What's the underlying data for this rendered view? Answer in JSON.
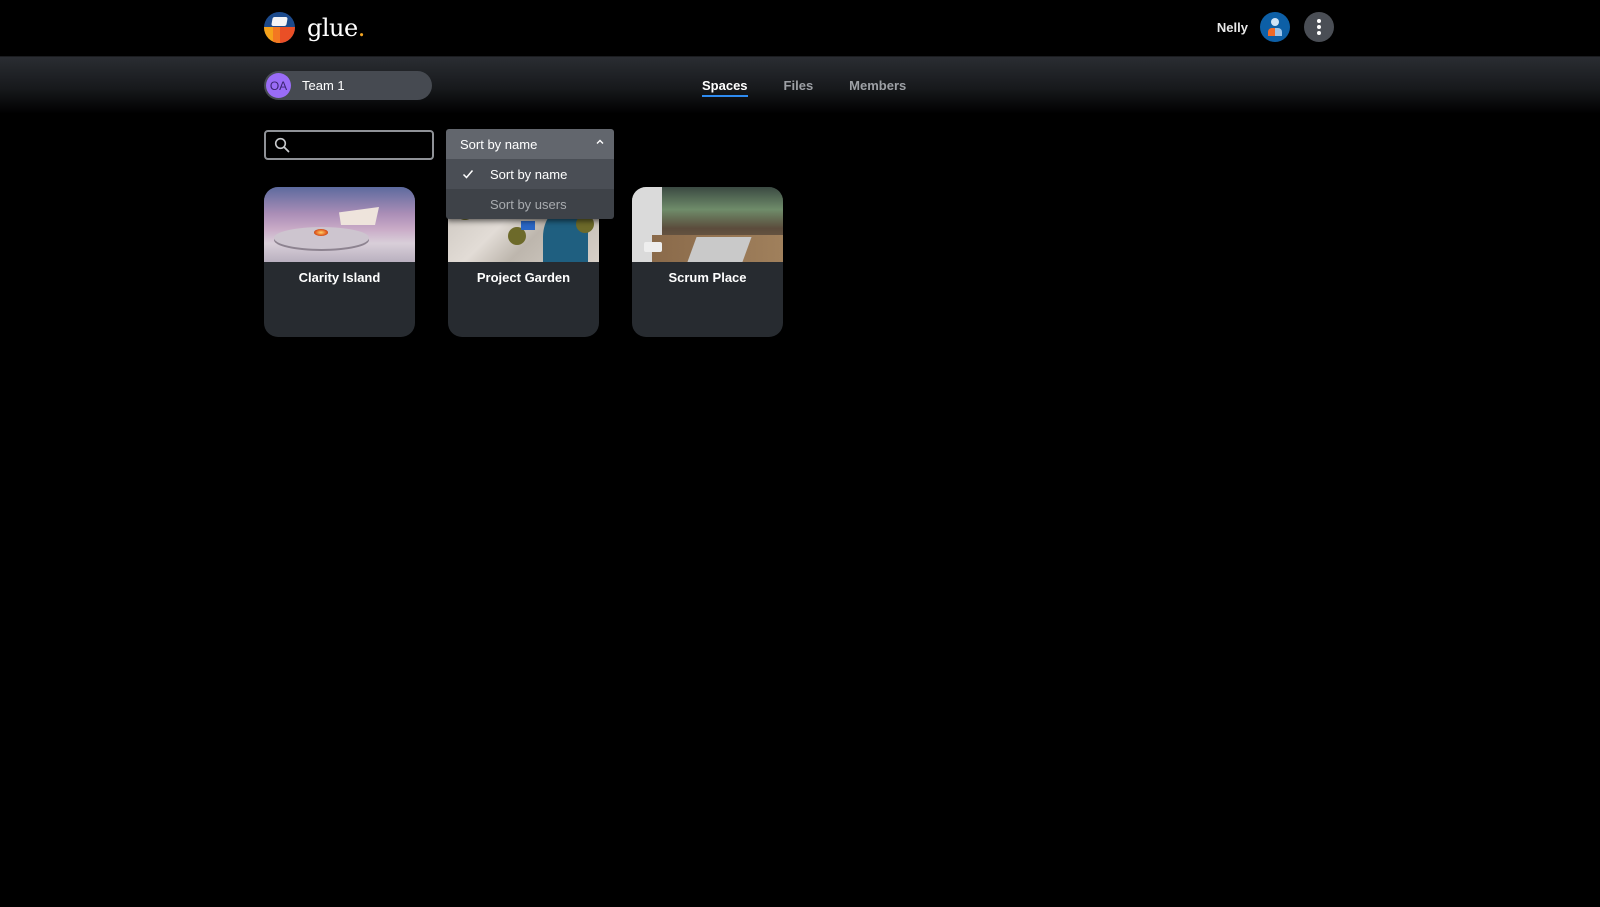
{
  "app": {
    "logo_text": "glue",
    "logo_dot": "."
  },
  "user": {
    "name": "Nelly",
    "avatar_icon": "user-avatar-icon",
    "menu_icon": "kebab-menu-icon"
  },
  "team": {
    "initials": "OA",
    "name": "Team 1",
    "badge_color": "#9a6cf7"
  },
  "nav": {
    "items": [
      {
        "label": "Spaces",
        "active": true
      },
      {
        "label": "Files",
        "active": false
      },
      {
        "label": "Members",
        "active": false
      }
    ],
    "active_color": "#2e8bf0"
  },
  "search": {
    "value": "",
    "placeholder": "",
    "icon": "search-icon"
  },
  "sort": {
    "selected": "Sort by name",
    "expanded": true,
    "options": [
      {
        "label": "Sort by name",
        "checked": true
      },
      {
        "label": "Sort by users",
        "checked": false
      }
    ]
  },
  "spaces": [
    {
      "name": "Clarity Island"
    },
    {
      "name": "Project Garden"
    },
    {
      "name": "Scrum Place"
    }
  ]
}
